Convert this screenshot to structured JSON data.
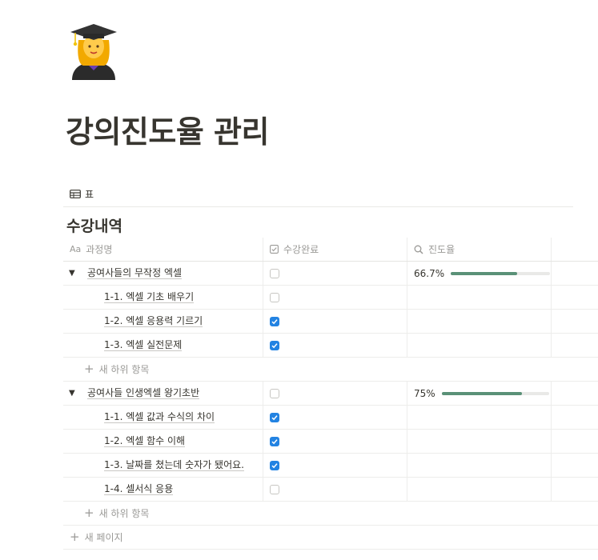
{
  "page": {
    "icon": "woman-student-emoji",
    "title": "강의진도율 관리"
  },
  "view": {
    "icon": "table-icon",
    "label": "표"
  },
  "database": {
    "title": "수강내역",
    "columns": [
      {
        "icon": "text-icon",
        "icon_text": "Aa",
        "label": "과정명"
      },
      {
        "icon": "checkbox-property-icon",
        "label": "수강완료"
      },
      {
        "icon": "formula-search-icon",
        "label": "진도율"
      }
    ],
    "groups": [
      {
        "title": "공여사들의 무작정 엑셀",
        "completed": false,
        "progress_label": "66.7%",
        "progress": 0.667,
        "children": [
          {
            "title": "1-1. 엑셀 기초 배우기",
            "completed": false
          },
          {
            "title": "1-2. 엑셀 응용력 기르기",
            "completed": true
          },
          {
            "title": "1-3. 엑셀 실전문제",
            "completed": true
          }
        ],
        "new_sub_label": "새 하위 항목"
      },
      {
        "title": "공여사들 인생엑셀 왕기초반",
        "completed": false,
        "progress_label": "75%",
        "progress": 0.75,
        "children": [
          {
            "title": "1-1. 엑셀 값과 수식의 차이",
            "completed": true
          },
          {
            "title": "1-2. 엑셀 함수 이해",
            "completed": true
          },
          {
            "title": "1-3. 날짜를 쳤는데 숫자가 됐어요.",
            "completed": true
          },
          {
            "title": "1-4. 셀서식 응용",
            "completed": false
          }
        ],
        "new_sub_label": "새 하위 항목"
      }
    ],
    "new_page_label": "새 페이지"
  },
  "colors": {
    "text": "#37352f",
    "muted": "#9b9a97",
    "checkbox_checked": "#2383e2",
    "progress_fill": "#5a9177",
    "progress_track": "#e9e9e7"
  }
}
